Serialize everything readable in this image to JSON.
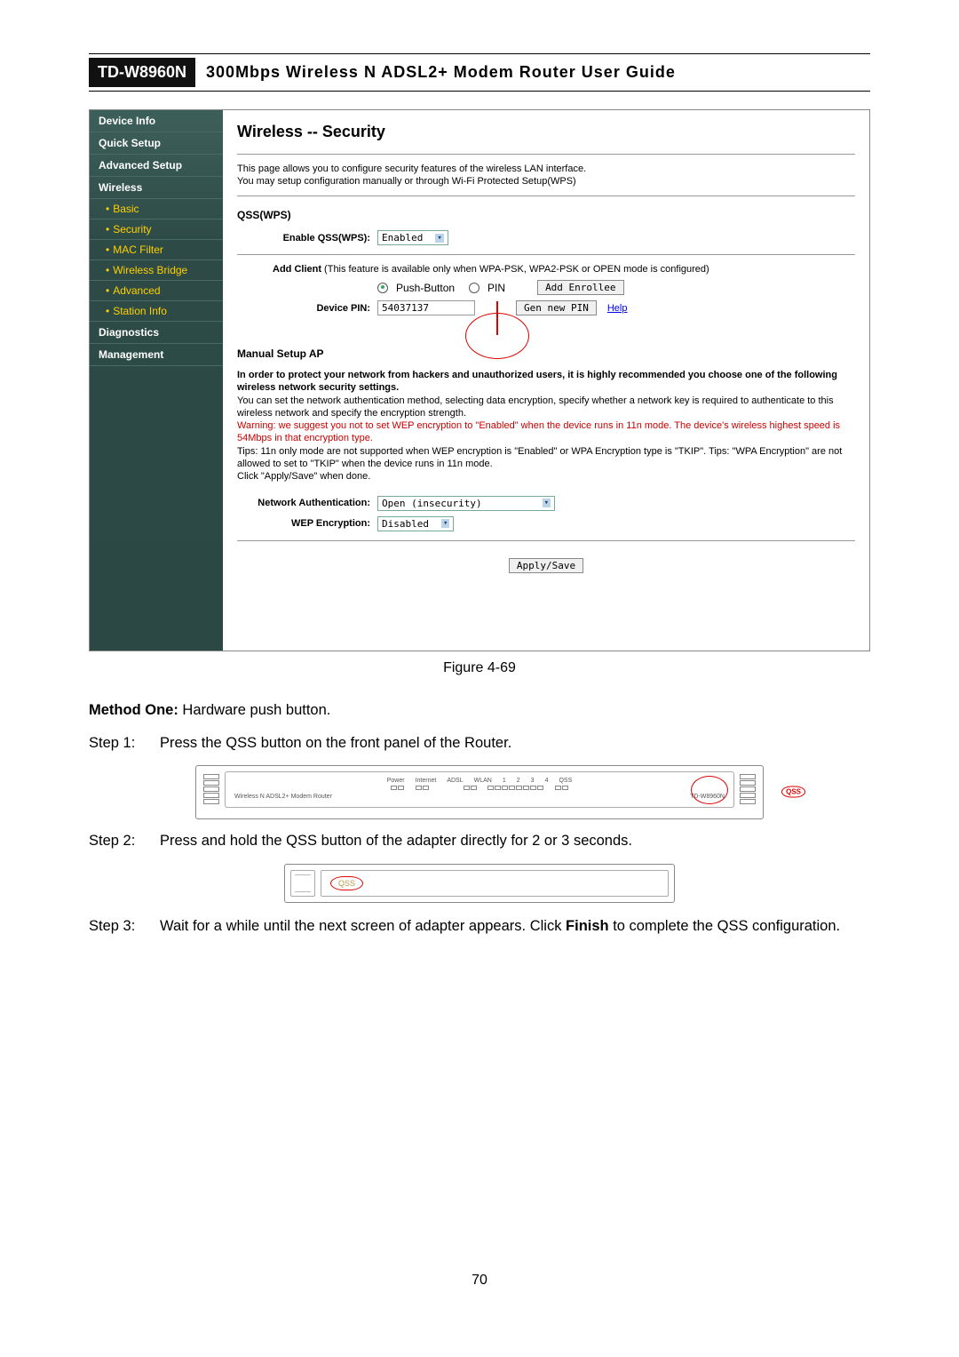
{
  "header": {
    "model": "TD-W8960N",
    "guide": "300Mbps  Wireless  N  ADSL2+  Modem  Router  User  Guide"
  },
  "sidebar": {
    "cats": [
      "Device Info",
      "Quick Setup",
      "Advanced Setup",
      "Wireless",
      "Diagnostics",
      "Management"
    ],
    "wireless_subs": [
      "Basic",
      "Security",
      "MAC Filter",
      "Wireless Bridge",
      "Advanced",
      "Station Info"
    ]
  },
  "security": {
    "title": "Wireless -- Security",
    "intro1": "This page allows you to configure security features of the wireless LAN interface.",
    "intro2": "You may setup configuration manually or through Wi-Fi Protected Setup(WPS)",
    "qss_heading": "QSS(WPS)",
    "enable_label": "Enable QSS(WPS):",
    "enable_value": "Enabled",
    "add_client_prefix": "Add Client",
    "add_client_note": " (This feature is available only when WPA-PSK, WPA2-PSK or OPEN mode is configured)",
    "mode_push": "Push-Button",
    "mode_pin": "PIN",
    "add_enrollee": "Add Enrollee",
    "device_pin_label": "Device PIN:",
    "device_pin_value": "54037137",
    "gen_pin": "Gen new PIN",
    "help": "Help",
    "manual_heading": "Manual Setup AP",
    "warn_bold": "In order to protect your network from hackers and unauthorized users, it is highly recommended you choose one of the following wireless network security settings.",
    "warn1": "You can set the network authentication method, selecting data encryption, specify whether a network key is required to authenticate to this wireless network and specify the encryption strength.",
    "warn_red": "Warning: we suggest you not to set WEP encryption to \"Enabled\" when the device runs in 11n mode. The device's wireless highest speed is 54Mbps in that encryption type.",
    "warn2": "Tips: 11n only mode are not supported when WEP encryption is \"Enabled\" or WPA Encryption type is \"TKIP\". Tips: \"WPA Encryption\" are not allowed to set to \"TKIP\" when the device runs in 11n mode.",
    "warn3": "Click \"Apply/Save\" when done.",
    "net_auth_label": "Network Authentication:",
    "net_auth_value": "Open (insecurity)",
    "wep_label": "WEP Encryption:",
    "wep_value": "Disabled",
    "apply": "Apply/Save"
  },
  "caption": "Figure 4-69",
  "method_one": "Method One:",
  "method_one_rest": " Hardware push button.",
  "steps": [
    {
      "n": "Step 1:",
      "t": "Press the QSS button on the front panel of the Router."
    },
    {
      "n": "Step 2:",
      "t": "Press and hold the QSS button of the adapter directly for 2 or 3 seconds."
    },
    {
      "n": "Step 3:",
      "t": "Wait for a while until the next screen of adapter appears. Click Finish to complete the QSS configuration."
    }
  ],
  "router_panel": {
    "leds": [
      "Power",
      "Internet",
      "ADSL",
      "WLAN",
      "1",
      "2",
      "3",
      "4",
      "QSS"
    ],
    "left_label": "Wireless N ADSL2+ Modem Router",
    "right_label": "TD-W8960N",
    "qss_btn": "QSS"
  },
  "adapter": {
    "qss": "QSS"
  },
  "page_number": "70"
}
